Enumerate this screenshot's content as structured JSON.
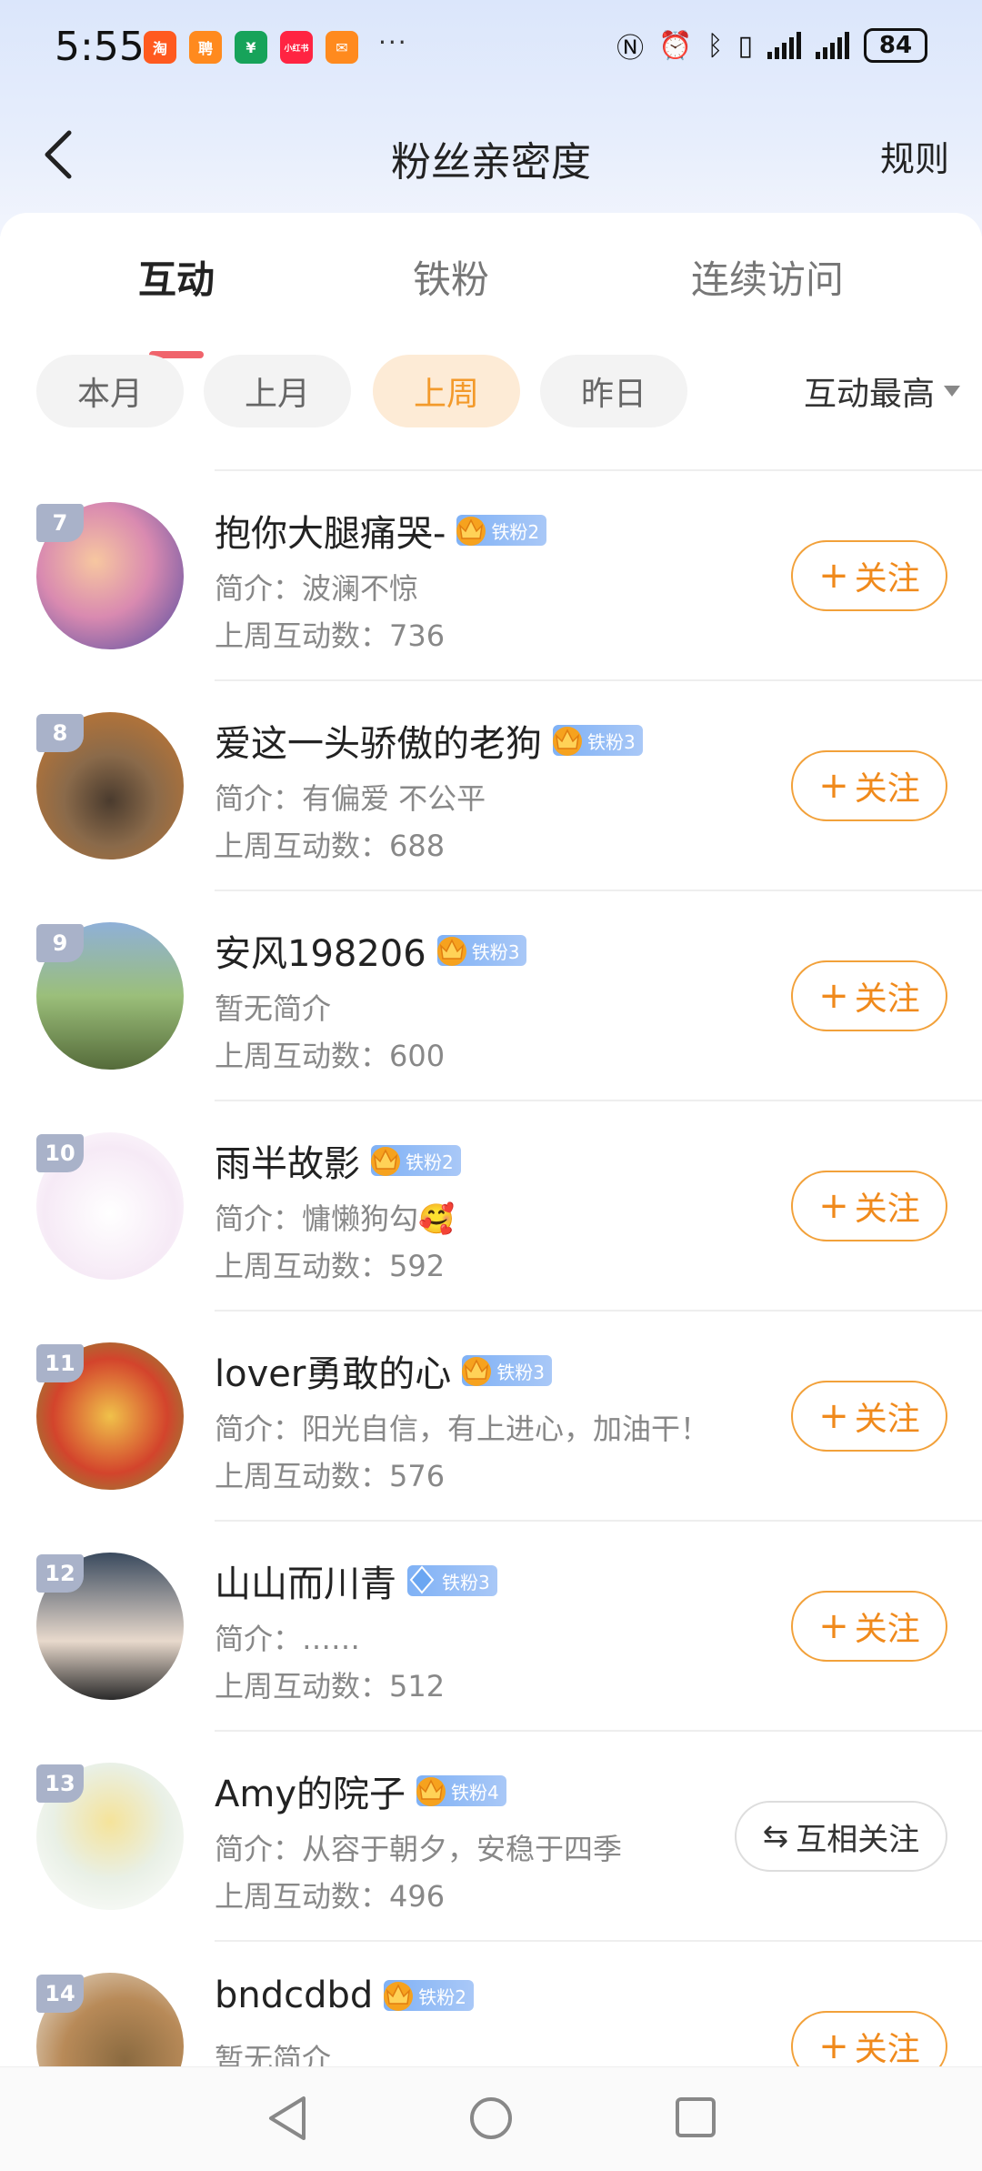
{
  "status_bar": {
    "time": "5:55",
    "app_icons": [
      {
        "name": "taobao-icon",
        "glyph": "淘",
        "color": "#ff5a1f"
      },
      {
        "name": "zhipin-icon",
        "glyph": "聘",
        "color": "#ff8a1e"
      },
      {
        "name": "wallet-icon",
        "glyph": "¥",
        "color": "#17a35a"
      },
      {
        "name": "xiaohongshu-icon",
        "glyph": "小红书",
        "color": "#ff2442"
      },
      {
        "name": "mail-icon",
        "glyph": "✉",
        "color": "#ff8a1e"
      }
    ],
    "more": "···",
    "battery": "84"
  },
  "nav": {
    "title": "粉丝亲密度",
    "rules": "规则"
  },
  "tabs": [
    "互动",
    "铁粉",
    "连续访问"
  ],
  "filters": [
    "本月",
    "上月",
    "上周",
    "昨日"
  ],
  "sort": "互动最高",
  "follow_label": "关注",
  "mutual_label": "互相关注",
  "fans": [
    {
      "rank": "7",
      "name": "抱你大腿痛哭-",
      "badge": "铁粉2",
      "crown_level": "4",
      "bio": "简介：波澜不惊",
      "count": "上周互动数：736",
      "action": "follow"
    },
    {
      "rank": "8",
      "name": "爱这一头骄傲的老狗",
      "badge": "铁粉3",
      "crown_level": "6",
      "bio": "简介：有偏爱 不公平",
      "count": "上周互动数：688",
      "action": "follow"
    },
    {
      "rank": "9",
      "name": "安风198206",
      "badge": "铁粉3",
      "crown_level": "2",
      "bio": "暂无简介",
      "count": "上周互动数：600",
      "action": "follow"
    },
    {
      "rank": "10",
      "name": "雨半故影",
      "badge": "铁粉2",
      "crown_level": "5",
      "bio": "简介：慵懒狗勾🥰",
      "count": "上周互动数：592",
      "action": "follow"
    },
    {
      "rank": "11",
      "name": "lover勇敢的心",
      "badge": "铁粉3",
      "crown_level": "5",
      "bio": "简介：阳光自信，有上进心，加油干！",
      "count": "上周互动数：576",
      "action": "follow"
    },
    {
      "rank": "12",
      "name": "山山而川青",
      "badge": "铁粉3",
      "crown_level": "",
      "bio": "简介：……",
      "count": "上周互动数：512",
      "action": "follow"
    },
    {
      "rank": "13",
      "name": "Amy的院子",
      "badge": "铁粉4",
      "crown_level": "3",
      "bio": "简介：从容于朝夕，安稳于四季",
      "count": "上周互动数：496",
      "action": "mutual"
    },
    {
      "rank": "14",
      "name": "bndcdbd",
      "badge": "铁粉2",
      "crown_level": "5",
      "bio": "暂无简介",
      "count": "",
      "action": "follow"
    }
  ],
  "colors": {
    "accent": "#f08a1c",
    "tab_indicator": "#f0646c",
    "chip_active_bg": "#fdebd6",
    "badge_blue": "#7fb1f5"
  }
}
